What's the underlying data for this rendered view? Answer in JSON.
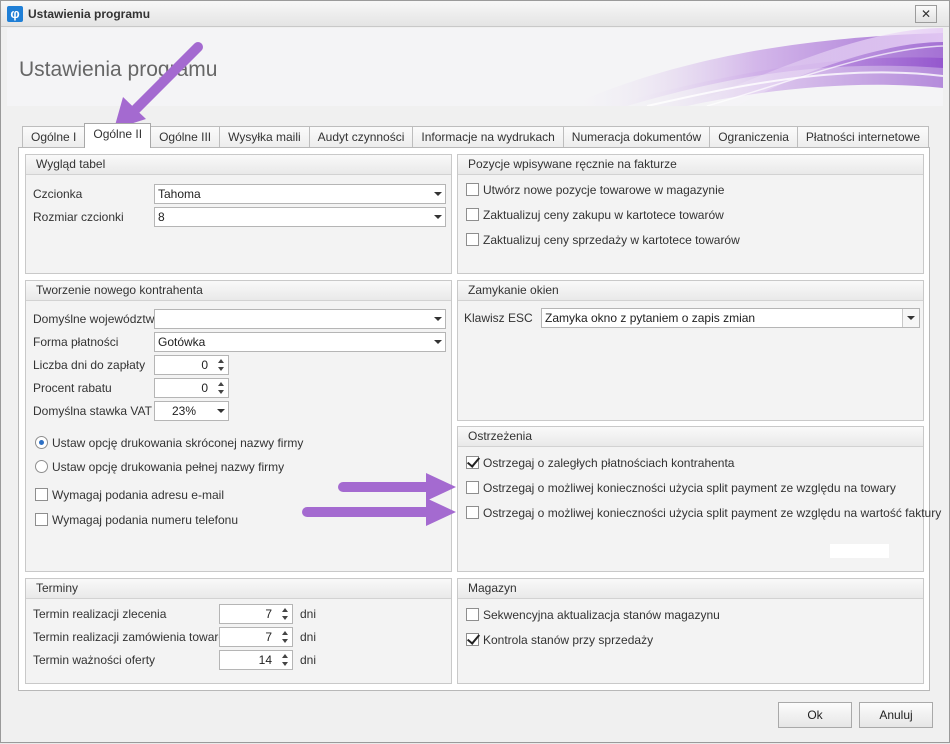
{
  "window": {
    "title": "Ustawienia programu",
    "close_glyph": "✕",
    "app_icon": "φ"
  },
  "header": {
    "title": "Ustawienia programu"
  },
  "tabs": [
    {
      "label": "Ogólne I",
      "active": false
    },
    {
      "label": "Ogólne II",
      "active": true
    },
    {
      "label": "Ogólne III",
      "active": false
    },
    {
      "label": "Wysyłka maili",
      "active": false
    },
    {
      "label": "Audyt czynności",
      "active": false
    },
    {
      "label": "Informacje na wydrukach",
      "active": false
    },
    {
      "label": "Numeracja dokumentów",
      "active": false
    },
    {
      "label": "Ograniczenia",
      "active": false
    },
    {
      "label": "Płatności internetowe",
      "active": false
    }
  ],
  "table_look": {
    "header": "Wygląd tabel",
    "font_label": "Czcionka",
    "font_value": "Tahoma",
    "font_size_label": "Rozmiar czcionki",
    "font_size_value": "8"
  },
  "new_contractor": {
    "header": "Tworzenie nowego kontrahenta",
    "voivodeship_label": "Domyślne województwo",
    "voivodeship_value": "",
    "payment_label": "Forma płatności",
    "payment_value": "Gotówka",
    "days_label": "Liczba dni do zapłaty",
    "days_value": "0",
    "discount_label": "Procent rabatu",
    "discount_value": "0",
    "vat_label": "Domyślna stawka VAT",
    "vat_value": "23%",
    "radio_short": "Ustaw opcję drukowania skróconej nazwy firmy",
    "radio_full": "Ustaw opcję drukowania pełnej nazwy firmy",
    "require_email": "Wymagaj podania adresu e-mail",
    "require_phone": "Wymagaj podania numeru telefonu"
  },
  "terms": {
    "header": "Terminy",
    "order_label": "Termin realizacji zlecenia",
    "order_value": "7",
    "goods_order_label": "Termin realizacji zamówienia towarów",
    "goods_order_value": "7",
    "offer_label": "Termin ważności oferty",
    "offer_value": "14",
    "unit": "dni"
  },
  "manual_items": {
    "header": "Pozycje wpisywane ręcznie na fakturze",
    "opt1": "Utwórz nowe pozycje towarowe w magazynie",
    "opt2": "Zaktualizuj ceny zakupu w kartotece towarów",
    "opt3": "Zaktualizuj ceny sprzedaży w kartotece towarów"
  },
  "closing": {
    "header": "Zamykanie okien",
    "esc_label": "Klawisz ESC",
    "esc_value": "Zamyka okno z pytaniem o zapis zmian"
  },
  "warnings": {
    "header": "Ostrzeżenia",
    "opt1": "Ostrzegaj o zaległych płatnościach kontrahenta",
    "opt2": "Ostrzegaj o możliwej konieczności użycia split payment ze względu na towary",
    "opt3": "Ostrzegaj o możliwej konieczności użycia split payment ze względu na wartość faktury"
  },
  "warehouse": {
    "header": "Magazyn",
    "opt1": "Sekwencyjna aktualizacja stanów magazynu",
    "opt2": "Kontrola stanów przy sprzedaży"
  },
  "footer": {
    "ok_label": "Ok",
    "cancel_label": "Anuluj"
  },
  "colors": {
    "annotation_arrow": "#a46ad0",
    "radio_dot": "#2d6fc4"
  }
}
